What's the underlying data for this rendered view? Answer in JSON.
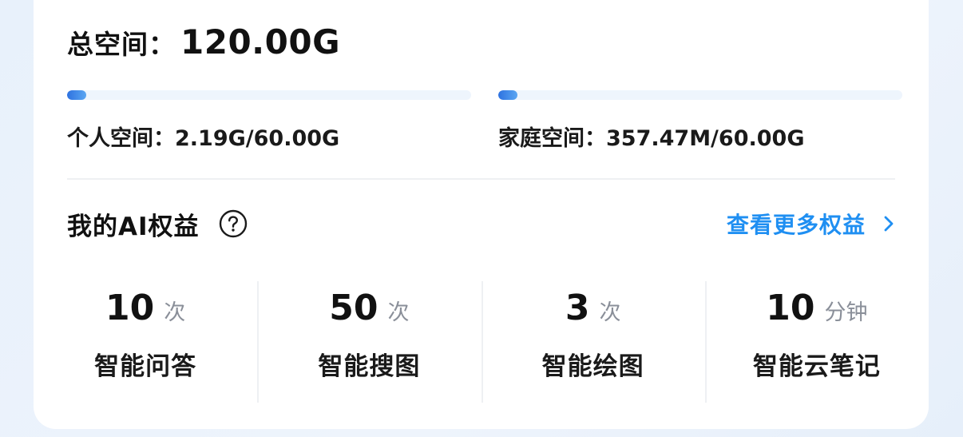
{
  "storage": {
    "total_label": "总空间：",
    "total_value": "120.00G",
    "personal": {
      "text": "个人空间：2.19G/60.00G",
      "used_fraction": 0.0365
    },
    "family": {
      "text": "家庭空间：357.47M/60.00G",
      "used_fraction": 0.0058
    }
  },
  "ai": {
    "title": "我的AI权益",
    "help_icon": "question-circle-icon",
    "more_label": "查看更多权益",
    "more_icon": "chevron-right-icon",
    "stats": [
      {
        "value": "10",
        "unit": "次",
        "label": "智能问答"
      },
      {
        "value": "50",
        "unit": "次",
        "label": "智能搜图"
      },
      {
        "value": "3",
        "unit": "次",
        "label": "智能绘图"
      },
      {
        "value": "10",
        "unit": "分钟",
        "label": "智能云笔记"
      }
    ]
  },
  "colors": {
    "accent": "#1f8ff2",
    "progress_start": "#2e72e0",
    "progress_end": "#5aa6f2",
    "track": "#eef5fd"
  }
}
